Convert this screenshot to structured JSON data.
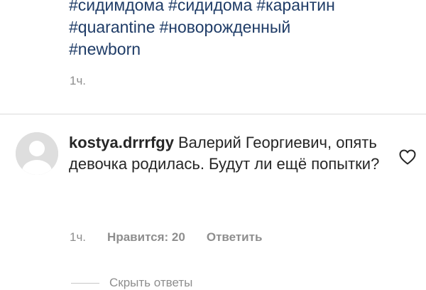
{
  "caption": {
    "tags": [
      "#сидимдома",
      "#сидидома",
      "#карантин",
      "#quarantine",
      "#новорожденный",
      "#newborn"
    ],
    "time": "1ч."
  },
  "comment": {
    "username": "kostya.drrrfgy",
    "text": "Валерий Георгиевич, опять девочка родилась. Будут ли ещё попытки?",
    "time": "1ч.",
    "likes": "Нравится: 20",
    "reply": "Ответить",
    "hidden_replies": "Скрыть ответы"
  },
  "icons": {
    "avatar": "default-avatar-icon",
    "like": "heart-outline-icon"
  },
  "colors": {
    "hashtag": "#1f3c67",
    "text": "#262626",
    "muted": "#8e8e8e",
    "divider": "#dbdbdb"
  }
}
